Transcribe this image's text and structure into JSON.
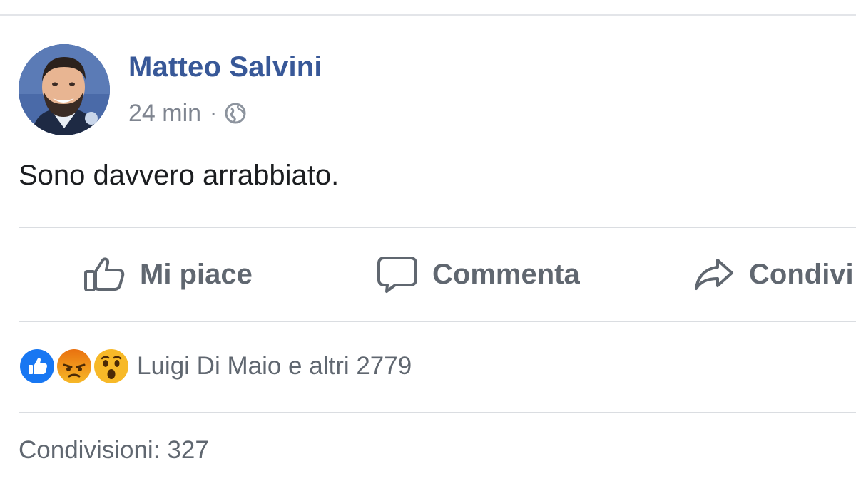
{
  "post": {
    "author": "Matteo Salvini",
    "timestamp": "24 min",
    "separator": "·",
    "privacy_icon": "globe-icon",
    "text": "Sono davvero arrabbiato."
  },
  "actions": {
    "like_label": "Mi piace",
    "comment_label": "Commenta",
    "share_label": "Condivi"
  },
  "reactions": {
    "icons": [
      "like-reaction-icon",
      "angry-reaction-icon",
      "wow-reaction-icon"
    ],
    "summary": "Luigi Di Maio e altri 2779"
  },
  "shares": {
    "label": "Condivisioni:",
    "count": "327"
  },
  "colors": {
    "author_link": "#385898",
    "secondary_text": "#606770",
    "like_blue": "#1877f2",
    "reaction_yellow": "#f7b928",
    "angry_orange": "#e9710f"
  }
}
